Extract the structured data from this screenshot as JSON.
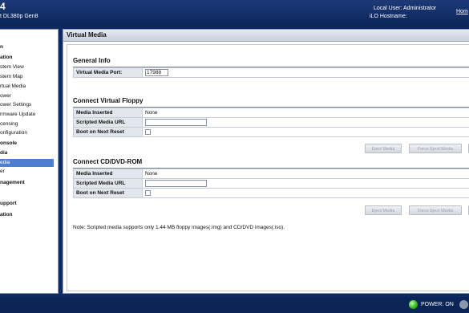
{
  "header": {
    "title": "4",
    "subtitle": "t DL380p Gen8",
    "local_user": "Local User:  Administrator",
    "ilo_hostname": "iLO Hostname:",
    "home_link": "Hom"
  },
  "sidebar": {
    "items": [
      {
        "label": "n",
        "bold": true
      },
      {
        "label": "ation",
        "bold": true
      },
      {
        "label": "stem View",
        "bold": false
      },
      {
        "label": "stem Map",
        "bold": false
      },
      {
        "label": "rtual Media",
        "bold": false
      },
      {
        "label": "ower",
        "bold": false
      },
      {
        "label": "ower Settings",
        "bold": false
      },
      {
        "label": "rmware Update",
        "bold": false
      },
      {
        "label": "censing",
        "bold": false
      },
      {
        "label": "onfiguration",
        "bold": false
      },
      {
        "label": "onsole",
        "bold": true
      },
      {
        "label": "dia",
        "bold": true
      },
      {
        "label": "edia",
        "bold": false,
        "selected": true
      },
      {
        "label": "er",
        "bold": false
      },
      {
        "label": "nagement",
        "bold": true
      },
      {
        "label": "upport",
        "bold": true
      },
      {
        "label": "ation",
        "bold": true
      }
    ]
  },
  "main": {
    "title": "Virtual Media",
    "general_info": {
      "heading": "General Info",
      "port_label": "Virtual Media Port:",
      "port_value": "17988"
    },
    "floppy": {
      "heading": "Connect Virtual Floppy",
      "media_inserted_label": "Media Inserted",
      "media_inserted_value": "None",
      "scripted_url_label": "Scripted Media URL",
      "scripted_url_value": "",
      "boot_next_label": "Boot on Next Reset",
      "boot_next_checked": false,
      "eject_label": "Eject Media",
      "force_eject_label": "Force Eject Media"
    },
    "cdrom": {
      "heading": "Connect CD/DVD-ROM",
      "media_inserted_label": "Media Inserted",
      "media_inserted_value": "None",
      "scripted_url_label": "Scripted Media URL",
      "scripted_url_value": "",
      "boot_next_label": "Boot on Next Reset",
      "boot_next_checked": false,
      "eject_label": "Eject Media",
      "force_eject_label": "Force Eject Media"
    },
    "note": "Note: Scripted media supports only 1.44 MB floppy images(.img) and CD/DVD images(.iso)."
  },
  "footer": {
    "power_status": "POWER: ON",
    "power_color": "#29b51e"
  }
}
